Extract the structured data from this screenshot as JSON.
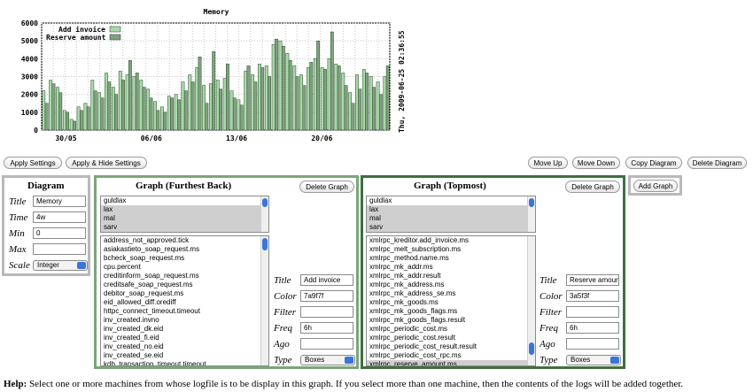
{
  "chart_data": {
    "type": "bar",
    "title": "Memory",
    "side_label": "Thu, 2009-06-25 02:36:55",
    "yticks": [
      "0",
      "1000",
      "2000",
      "3000",
      "4000",
      "5000",
      "6000"
    ],
    "ylim": [
      0,
      6000
    ],
    "xticks": [
      "30/05",
      "06/06",
      "13/06",
      "20/06"
    ],
    "series": [
      {
        "name": "Add invoice",
        "color": "#a9d9a9",
        "values": [
          2200,
          2800,
          2400,
          1100,
          600,
          1300,
          1500,
          2800,
          2100,
          3200,
          2400,
          3300,
          3100,
          3000,
          2800,
          2300,
          1600,
          1300,
          1900,
          2000,
          2700,
          3100,
          3500,
          2500,
          2600,
          2800,
          2900,
          2200,
          1700,
          3300,
          3100,
          3700,
          3600,
          4800,
          5000,
          4300,
          3600,
          3100,
          3500,
          4000,
          3500,
          4000,
          3700,
          3200,
          2100,
          3100,
          3400,
          3000,
          2700,
          3000
        ]
      },
      {
        "name": "Reserve amount",
        "color": "#7fa37f",
        "values": [
          1500,
          2600,
          2100,
          1000,
          500,
          1100,
          1300,
          2200,
          1800,
          2700,
          2000,
          2800,
          3900,
          3200,
          2400,
          1800,
          1100,
          1000,
          1800,
          1700,
          2200,
          2700,
          4100,
          1500,
          4400,
          2300,
          3700,
          1800,
          1400,
          3600,
          2700,
          3500,
          3000,
          5100,
          4700,
          3900,
          3000,
          2500,
          3800,
          5000,
          3400,
          5500,
          3600,
          2500,
          1500,
          2300,
          3200,
          2400,
          2000,
          3600
        ]
      }
    ]
  },
  "actions_left": [
    "Apply Settings",
    "Apply & Hide Settings"
  ],
  "actions_right": [
    "Move Up",
    "Move Down",
    "Copy Diagram",
    "Delete Diagram"
  ],
  "diagram": {
    "title": "Diagram",
    "labels": [
      "Title",
      "Time",
      "Min",
      "Max",
      "Scale"
    ],
    "title_value": "Memory",
    "time_value": "4w",
    "min_value": "0",
    "max_value": "",
    "scale_value": "Integer"
  },
  "graph1": {
    "title": "Graph (Furthest Back)",
    "delete_label": "Delete Graph",
    "machines": [
      "guldlax",
      "lax",
      "mal",
      "sarv"
    ],
    "logs": [
      "address_not_approved.tick",
      "asiakastieto_soap_request.ms",
      "bcheck_soap_request.ms",
      "cpu.percent",
      "creditinform_soap_request.ms",
      "creditsafe_soap_request.ms",
      "debitor_soap_request.ms",
      "eid_allowed_diff.orediff",
      "httpc_connect_timeout.timeout",
      "inv_created.invno",
      "inv_created_dk.eid",
      "inv_created_fi.eid",
      "inv_created_no.eid",
      "inv_created_se.eid",
      "kdb_transaction_timeout.timeout"
    ],
    "labels": [
      "Title",
      "Color",
      "Filter",
      "Freq",
      "Ago",
      "Type"
    ],
    "title_value": "Add invoice",
    "color_value": "7a9f7f",
    "filter_value": "",
    "freq_value": "6h",
    "ago_value": "",
    "type_value": "Boxes"
  },
  "graph2": {
    "title": "Graph (Topmost)",
    "delete_label": "Delete Graph",
    "machines": [
      "guldlax",
      "lax",
      "mal",
      "sarv"
    ],
    "logs": [
      "xmlrpc_kreditor.add_invoice.ms",
      "xmlrpc_melt_subscription.ms",
      "xmlrpc_method.name.ms",
      "xmlrpc_mk_addr.ms",
      "xmlrpc_mk_addr.result",
      "xmlrpc_mk_address.ms",
      "xmlrpc_mk_address_se.ms",
      "xmlrpc_mk_goods.ms",
      "xmlrpc_mk_goods_flags.ms",
      "xmlrpc_mk_goods_flags.result",
      "xmlrpc_periodic_cost.ms",
      "xmlrpc_periodic_cost.result",
      "xmlrpc_periodic_cost_result.result",
      "xmlrpc_periodic_cost_rpc.ms",
      "xmlrpc_reserve_amount.ms"
    ],
    "labels": [
      "Title",
      "Color",
      "Filter",
      "Freq",
      "Ago",
      "Type"
    ],
    "title_value": "Reserve amoun",
    "color_value": "3a5f3f",
    "filter_value": "",
    "freq_value": "6h",
    "ago_value": "",
    "type_value": "Boxes"
  },
  "add_graph_label": "Add Graph",
  "help": {
    "bold": "Help:",
    "text": " Select one or more machines from whose logfile is to be display in this graph. If you select more than one machine, then the contents of the logs will be added together."
  }
}
